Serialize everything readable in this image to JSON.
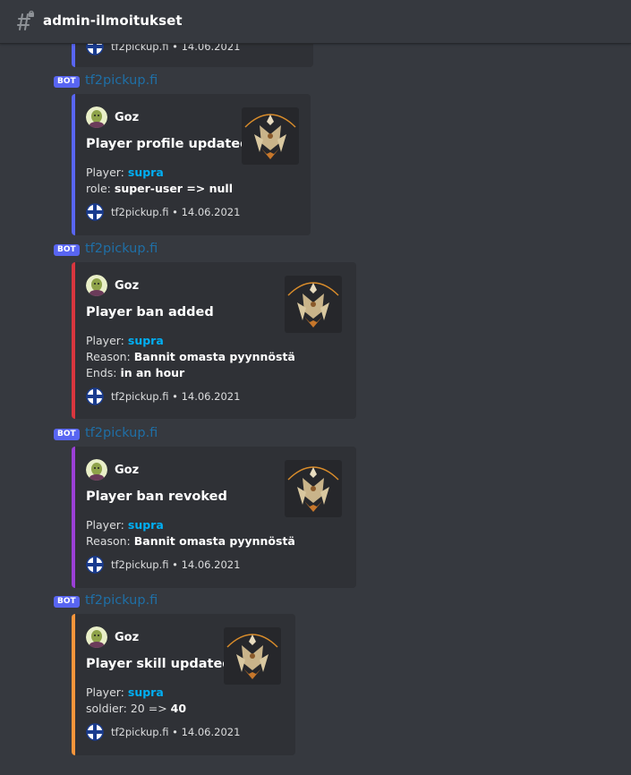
{
  "header": {
    "channel_name": "admin-ilmoitukset",
    "icon": "locked-hash-icon"
  },
  "bot": {
    "tag": "BOT",
    "name": "tf2pickup.fi"
  },
  "partial_footer": {
    "source": "tf2pickup.fi",
    "sep": "•",
    "date": "14.06.2021"
  },
  "messages": [
    {
      "bot_name": "tf2pickup.fi",
      "accent": "#5865f2",
      "author": "Goz",
      "title": "Player profile updated",
      "fields": [
        {
          "label": "Player:",
          "value": "supra",
          "link": true,
          "bold_label": false
        },
        {
          "label": "role:",
          "value": "super-user => null",
          "link": false,
          "bold_label": false
        }
      ],
      "footer_source": "tf2pickup.fi",
      "footer_sep": "•",
      "footer_date": "14.06.2021"
    },
    {
      "bot_name": "tf2pickup.fi",
      "accent": "#d9363e",
      "author": "Goz",
      "title": "Player ban added",
      "fields": [
        {
          "label": "Player:",
          "value": "supra",
          "link": true
        },
        {
          "label": "Reason:",
          "value": "Bannit omasta pyynnöstä",
          "link": false
        },
        {
          "label": "Ends:",
          "value": "in an hour",
          "link": false
        }
      ],
      "footer_source": "tf2pickup.fi",
      "footer_sep": "•",
      "footer_date": "14.06.2021"
    },
    {
      "bot_name": "tf2pickup.fi",
      "accent": "#9b3fd6",
      "author": "Goz",
      "title": "Player ban revoked",
      "fields": [
        {
          "label": "Player:",
          "value": "supra",
          "link": true
        },
        {
          "label": "Reason:",
          "value": "Bannit omasta pyynnöstä",
          "link": false
        }
      ],
      "footer_source": "tf2pickup.fi",
      "footer_sep": "•",
      "footer_date": "14.06.2021"
    },
    {
      "bot_name": "tf2pickup.fi",
      "accent": "#f7953b",
      "author": "Goz",
      "title": "Player skill updated",
      "fields": [
        {
          "label": "Player:",
          "value": "supra",
          "link": true
        },
        {
          "label": "soldier: 20 =>",
          "value": "40",
          "link": false
        }
      ],
      "footer_source": "tf2pickup.fi",
      "footer_sep": "•",
      "footer_date": "14.06.2021"
    }
  ]
}
